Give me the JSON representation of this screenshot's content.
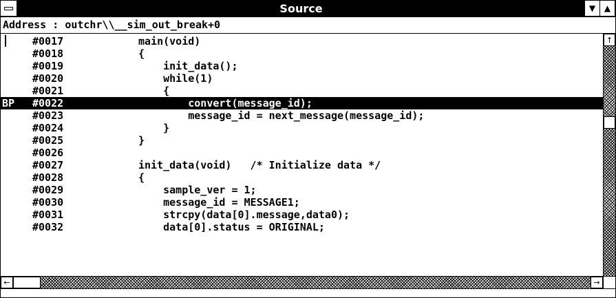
{
  "window": {
    "title": "Source"
  },
  "icons": {
    "system_menu": "system-menu-icon",
    "minimize": "minimize-arrow-icon",
    "maximize": "maximize-arrow-icon",
    "scroll_up": "up-arrow-icon",
    "scroll_left": "left-arrow-icon",
    "scroll_right": "right-arrow-icon"
  },
  "address": {
    "label": "Address : ",
    "value": "outchr\\\\__sim_out_break+0"
  },
  "lines": [
    {
      "mark": "",
      "num": "#0017",
      "code": "main(void)"
    },
    {
      "mark": "",
      "num": "#0018",
      "code": "{"
    },
    {
      "mark": "",
      "num": "#0019",
      "code": "    init_data();"
    },
    {
      "mark": "",
      "num": "#0020",
      "code": "    while(1)"
    },
    {
      "mark": "",
      "num": "#0021",
      "code": "    {"
    },
    {
      "mark": "BP",
      "num": "#0022",
      "code": "        convert(message_id);"
    },
    {
      "mark": "",
      "num": "#0023",
      "code": "        message_id = next_message(message_id);"
    },
    {
      "mark": "",
      "num": "#0024",
      "code": "    }"
    },
    {
      "mark": "",
      "num": "#0025",
      "code": "}"
    },
    {
      "mark": "",
      "num": "#0026",
      "code": ""
    },
    {
      "mark": "",
      "num": "#0027",
      "code": "init_data(void)   /* Initialize data */"
    },
    {
      "mark": "",
      "num": "#0028",
      "code": "{"
    },
    {
      "mark": "",
      "num": "#0029",
      "code": "    sample_ver = 1;"
    },
    {
      "mark": "",
      "num": "#0030",
      "code": "    message_id = MESSAGE1;"
    },
    {
      "mark": "",
      "num": "#0031",
      "code": "    strcpy(data[0].message,data0);"
    },
    {
      "mark": "",
      "num": "#0032",
      "code": "    data[0].status = ORIGINAL;"
    }
  ]
}
